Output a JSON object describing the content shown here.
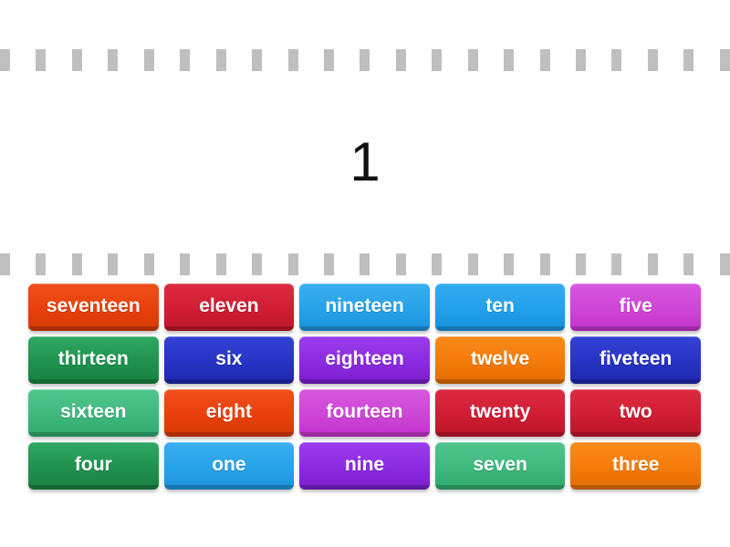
{
  "game": {
    "prompt": "1",
    "separator_dash_color": "#bfbfbf",
    "dash_count": 21,
    "background_color": "#ffffff"
  },
  "tiles": [
    {
      "label": "seventeen",
      "color": "#e8400c",
      "color_top": "#f0501c",
      "color_bottom": "#d43a06"
    },
    {
      "label": "eleven",
      "color": "#cf1d33",
      "color_top": "#dc2b41",
      "color_bottom": "#bb1628"
    },
    {
      "label": "nineteen",
      "color": "#28a2e8",
      "color_top": "#3aaeef",
      "color_bottom": "#1b93da"
    },
    {
      "label": "ten",
      "color": "#22a0ea",
      "color_top": "#36ace f",
      "color_bottom": "#1690db"
    },
    {
      "label": "five",
      "color": "#cd46d6",
      "color_top": "#d758de",
      "color_bottom": "#c232cc"
    },
    {
      "label": "thirteen",
      "color": "#209150",
      "color_top": "#2fa862",
      "color_bottom": "#18803f"
    },
    {
      "label": "six",
      "color": "#2733c4",
      "color_top": "#3442d4",
      "color_bottom": "#1d27ad"
    },
    {
      "label": "eighteen",
      "color": "#8b2be0",
      "color_top": "#9a3ded",
      "color_bottom": "#7a1dcd"
    },
    {
      "label": "twelve",
      "color": "#f47b0a",
      "color_top": "#fa8a1c",
      "color_bottom": "#e26c02"
    },
    {
      "label": "fiveteen",
      "color": "#2733c4",
      "color_top": "#3442d4",
      "color_bottom": "#1d27ad"
    },
    {
      "label": "sixteen",
      "color": "#3fb87e",
      "color_top": "#50c68d",
      "color_bottom": "#2fa86d"
    },
    {
      "label": "eight",
      "color": "#e8400c",
      "color_top": "#f0501c",
      "color_bottom": "#d43a06"
    },
    {
      "label": "fourteen",
      "color": "#cd46d6",
      "color_top": "#d758de",
      "color_bottom": "#c232cc"
    },
    {
      "label": "twenty",
      "color": "#cf1d33",
      "color_top": "#dc2b41",
      "color_bottom": "#bb1628"
    },
    {
      "label": "two",
      "color": "#cf1d33",
      "color_top": "#dc2b41",
      "color_bottom": "#bb1628"
    },
    {
      "label": "four",
      "color": "#209150",
      "color_top": "#2fa862",
      "color_bottom": "#18803f"
    },
    {
      "label": "one",
      "color": "#28a2e8",
      "color_top": "#3aaeef",
      "color_bottom": "#1b93da"
    },
    {
      "label": "nine",
      "color": "#8b2be0",
      "color_top": "#9a3ded",
      "color_bottom": "#7a1dcd"
    },
    {
      "label": "seven",
      "color": "#3fb87e",
      "color_top": "#50c68d",
      "color_bottom": "#2fa86d"
    },
    {
      "label": "three",
      "color": "#f47b0a",
      "color_top": "#fa8a1c",
      "color_bottom": "#e26c02"
    }
  ]
}
